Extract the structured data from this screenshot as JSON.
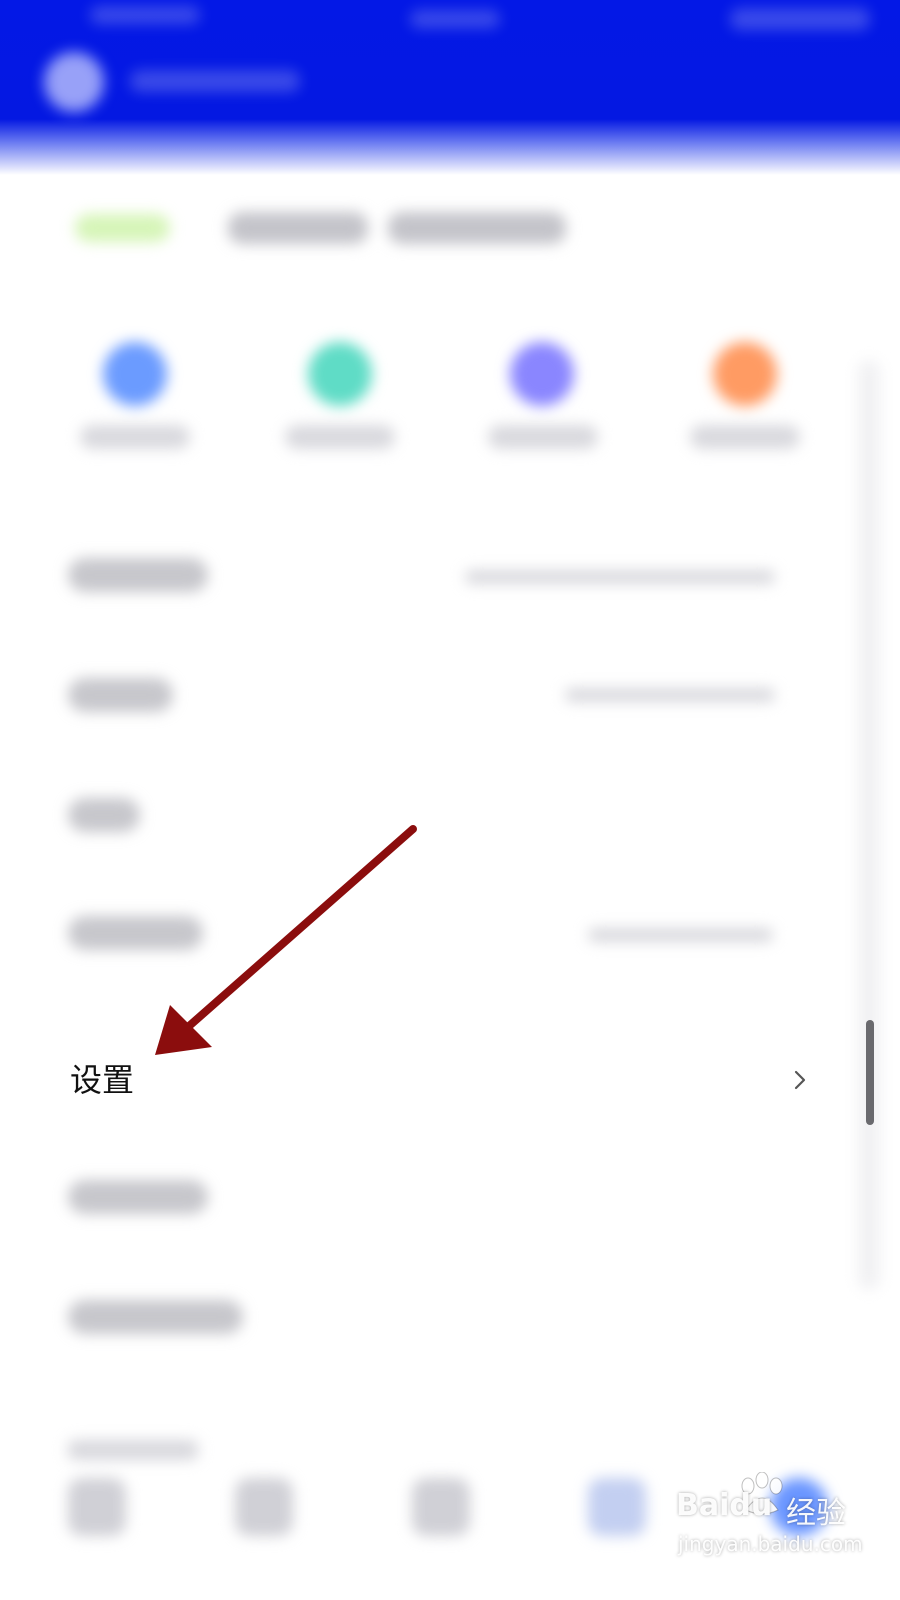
{
  "settings": {
    "label": "设置"
  },
  "watermark": {
    "brand": "Baidu",
    "product": "经验",
    "url": "jingyan.baidu.com"
  },
  "colors": {
    "header": "#0418e2",
    "arrow": "#8b0d0d"
  },
  "icons": {
    "settings_chevron": "chevron-right-icon",
    "annotation": "arrow-annotation"
  }
}
